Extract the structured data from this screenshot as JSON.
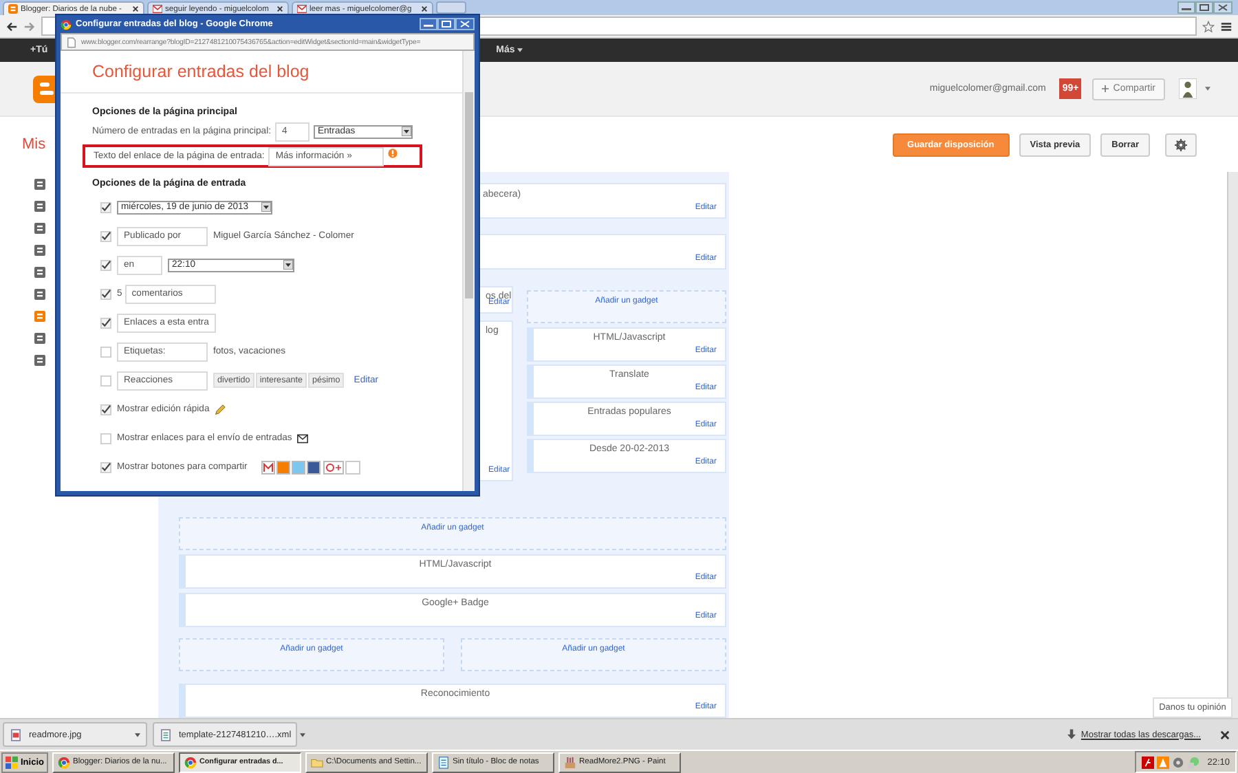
{
  "browser": {
    "tabs": [
      {
        "title": "Blogger: Diarios de la nube -",
        "kind": "blog",
        "selected": true
      },
      {
        "title": "seguir leyendo - miguelcolom",
        "kind": "mail",
        "selected": false
      },
      {
        "title": "leer mas - miguelcolomer@g",
        "kind": "mail",
        "selected": false
      }
    ]
  },
  "google_bar": {
    "items": [
      "+Tú",
      "Más"
    ]
  },
  "blogger_header": {
    "email": "miguelcolomer@gmail.com",
    "notifications": "99+",
    "share_button": "Compartir"
  },
  "toolbar": {
    "title": "Mis",
    "buttons": [
      {
        "label": "Guardar disposición",
        "kind": "primary"
      },
      {
        "label": "Vista previa",
        "kind": "default"
      },
      {
        "label": "Borrar",
        "kind": "default"
      }
    ]
  },
  "sidebar": {
    "items": [
      {
        "selected": false
      },
      {
        "selected": false
      },
      {
        "selected": false
      },
      {
        "selected": false
      },
      {
        "selected": false
      },
      {
        "selected": false
      },
      {
        "selected": true
      },
      {
        "selected": false
      },
      {
        "selected": false
      }
    ]
  },
  "layout": {
    "header_gadget": {
      "title": "abecera)",
      "edit": "Editar"
    },
    "second_gadget": {
      "edit": "Editar"
    },
    "main_column": [
      {
        "title": "os del",
        "edit": "Editar"
      },
      {
        "title": "log",
        "edit": "Editar"
      }
    ],
    "sidebar_column": {
      "add": "Añadir un gadget",
      "gadgets": [
        {
          "title": "HTML/Javascript",
          "edit": "Editar"
        },
        {
          "title": "Translate",
          "edit": "Editar"
        },
        {
          "title": "Entradas populares",
          "edit": "Editar"
        },
        {
          "title": "Desde 20-02-2013",
          "edit": "Editar"
        }
      ]
    },
    "footer": {
      "add": "Añadir un gadget",
      "gadgets": [
        {
          "title": "HTML/Javascript",
          "edit": "Editar"
        },
        {
          "title": "Google+ Badge",
          "edit": "Editar"
        }
      ]
    },
    "footer_columns": [
      "Añadir un gadget",
      "Añadir un gadget"
    ],
    "bottom_gadget": {
      "title": "Reconocimiento",
      "edit": "Editar"
    }
  },
  "feedback_button": "Danos tu opinión",
  "popup": {
    "window_title": "Configurar entradas del blog - Google Chrome",
    "url": "www.blogger.com/rearrange?blogID=2127481210075436765&action=editWidget&sectionId=main&widgetType=",
    "heading": "Configurar entradas del blog",
    "main_section": {
      "title": "Opciones de la página principal",
      "count_label": "Número de entradas en la página principal:",
      "count_value": "4",
      "count_unit": "Entradas",
      "link_label": "Texto del enlace de la página de entrada:",
      "link_value": "Más información »"
    },
    "post_section": {
      "title": "Opciones de la página de entrada",
      "rows": [
        {
          "kind": "select",
          "checked": true,
          "value": "miércoles, 19 de junio de 2013"
        },
        {
          "kind": "input_text",
          "checked": true,
          "value": "Publicado por",
          "text": "Miguel García Sánchez - Colomer"
        },
        {
          "kind": "input_select",
          "checked": true,
          "value": "en",
          "option": "22:10"
        },
        {
          "kind": "count_input",
          "checked": true,
          "count": "5",
          "value": "comentarios"
        },
        {
          "kind": "input",
          "checked": true,
          "value": "Enlaces a esta entra"
        },
        {
          "kind": "input_text",
          "checked": false,
          "value": "Etiquetas:",
          "text": "fotos, vacaciones"
        },
        {
          "kind": "reactions",
          "checked": false,
          "value": "Reacciones",
          "options": [
            "divertido",
            "interesante",
            "pésimo"
          ],
          "link": "Editar"
        },
        {
          "kind": "quickedit",
          "checked": true,
          "label": "Mostrar edición rápida"
        },
        {
          "kind": "emaillink",
          "checked": false,
          "label": "Mostrar enlaces para el envío de entradas"
        },
        {
          "kind": "share",
          "checked": true,
          "label": "Mostrar botones para compartir"
        }
      ]
    }
  },
  "downloads": {
    "files": [
      {
        "name": "readmore.jpg",
        "kind": "image"
      },
      {
        "name": "template-2127481210….xml",
        "kind": "document"
      }
    ],
    "show_all": "Mostrar todas las descargas..."
  },
  "taskbar": {
    "start": "Inicio",
    "items": [
      {
        "label": "Blogger: Diarios de la nu...",
        "kind": "browser",
        "selected": false
      },
      {
        "label": "Configurar entradas d...",
        "kind": "browser",
        "selected": true
      },
      {
        "label": "C:\\Documents and Settin...",
        "kind": "folder",
        "selected": false
      },
      {
        "label": "Sin título - Bloc de notas",
        "kind": "notepad",
        "selected": false
      },
      {
        "label": "ReadMore2.PNG - Paint",
        "kind": "paint",
        "selected": false
      }
    ],
    "clock": "22:10"
  }
}
